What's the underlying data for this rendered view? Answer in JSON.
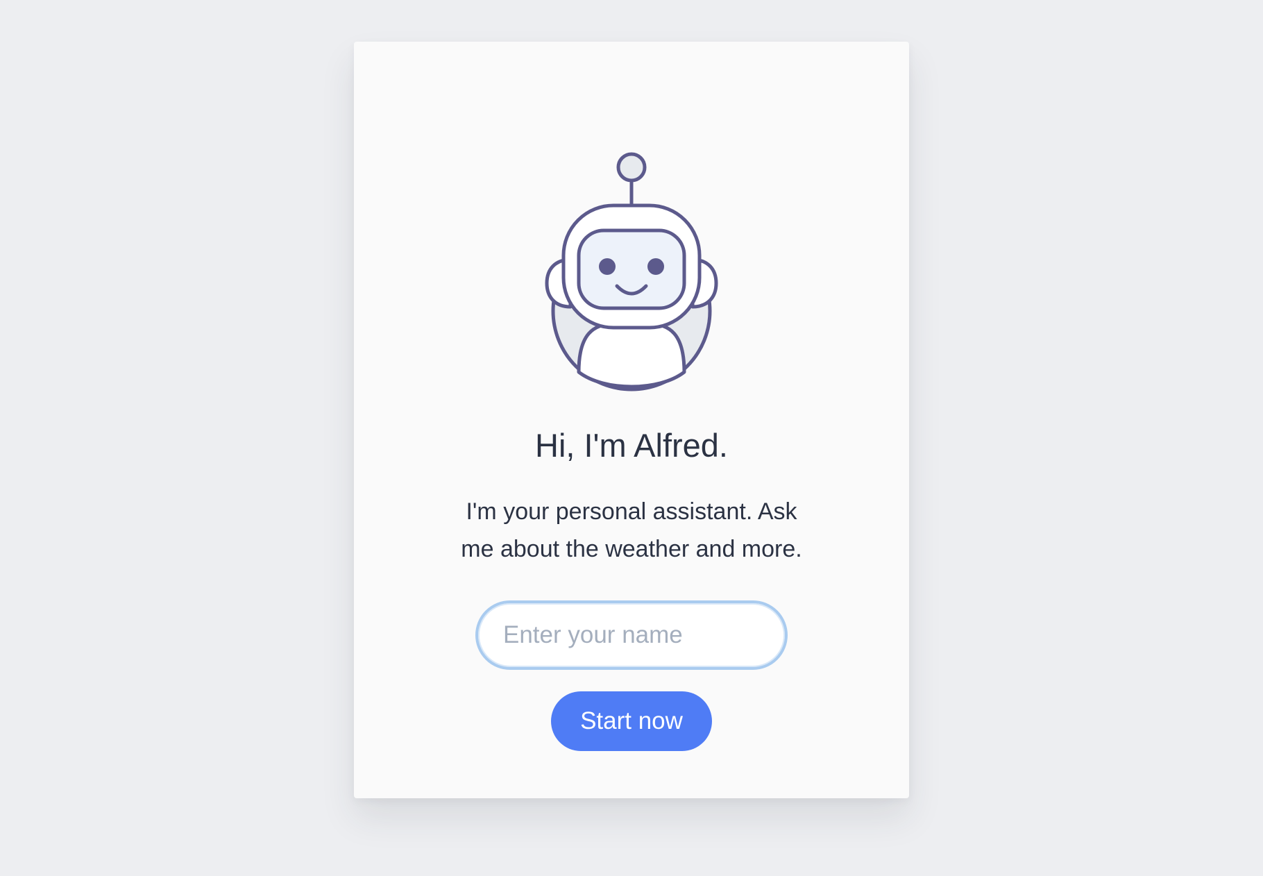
{
  "assistant": {
    "avatar_icon": "robot-icon",
    "greeting": "Hi, I'm Alfred.",
    "description": "I'm your personal assistant. Ask me about the weather and more."
  },
  "form": {
    "name_placeholder": "Enter your name",
    "name_value": "",
    "start_button_label": "Start now"
  },
  "colors": {
    "background": "#edeef1",
    "card": "#fafafa",
    "text": "#2b3243",
    "accent": "#4f7cf5",
    "robot_stroke": "#5c5a8c",
    "input_focus_ring": "#a9cbef",
    "placeholder": "#a4aebd"
  }
}
